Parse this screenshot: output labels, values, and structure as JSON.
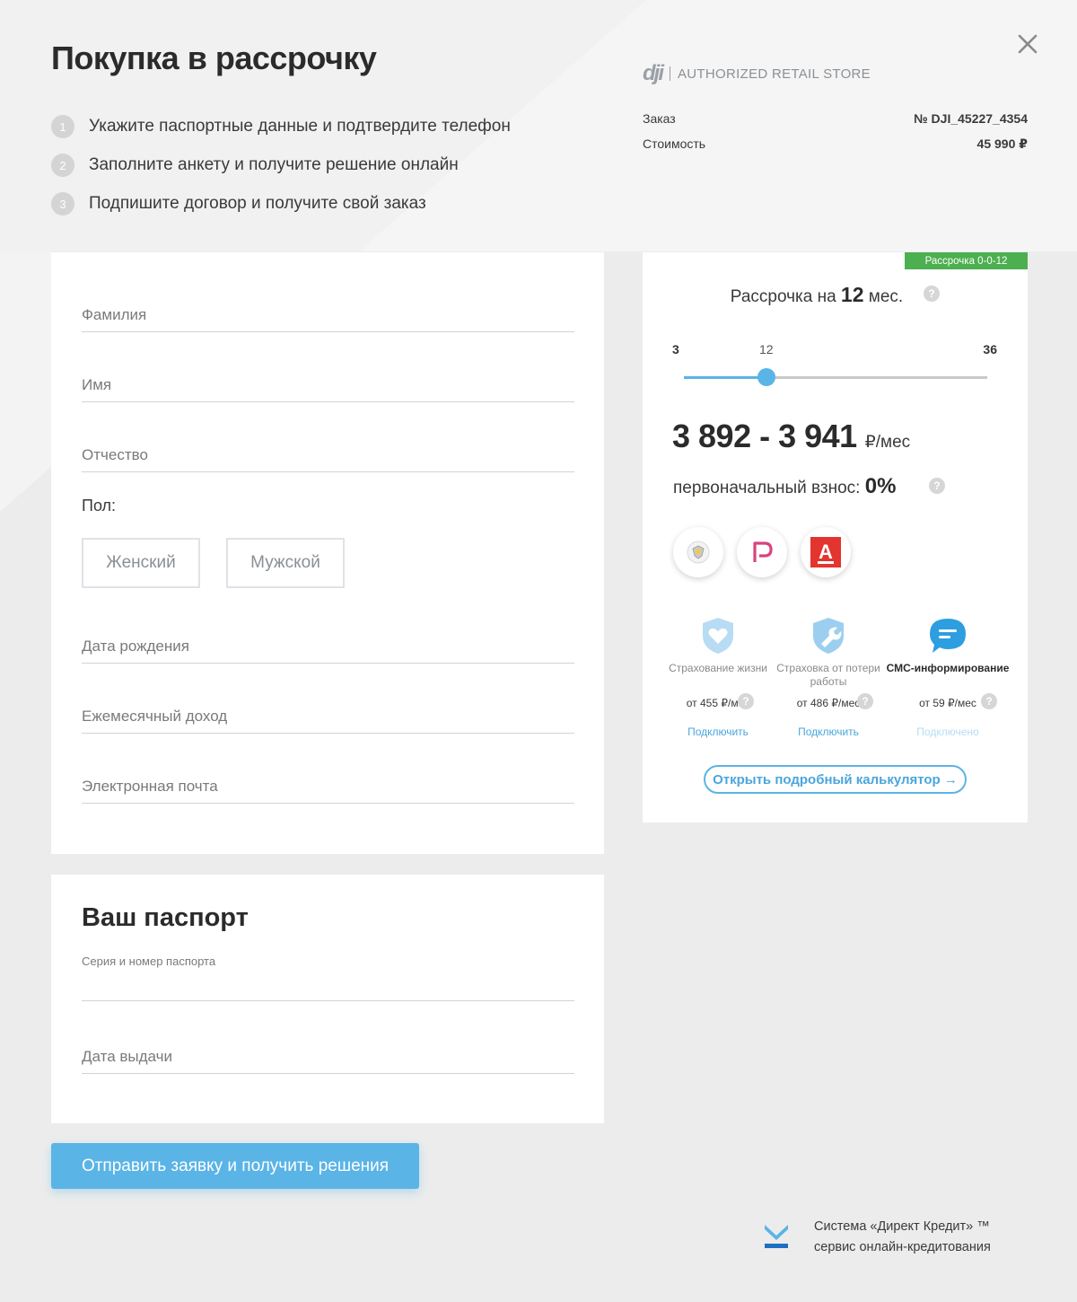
{
  "page": {
    "title": "Покупка в рассрочку"
  },
  "steps": [
    {
      "num": "1",
      "text": "Укажите паспортные данные и подтвердите телефон"
    },
    {
      "num": "2",
      "text": "Заполните анкету и получите решение онлайн"
    },
    {
      "num": "3",
      "text": "Подпишите договор и получите свой заказ"
    }
  ],
  "brand": {
    "logo": "dji",
    "text": "AUTHORIZED RETAIL STORE",
    "logo_color": "#9aa0a6"
  },
  "order": {
    "order_label": "Заказ",
    "order_value": "№ DJI_45227_4354",
    "price_label": "Стоимость",
    "price_value": "45 990 ₽"
  },
  "form": {
    "last_name": "Фамилия",
    "first_name": "Имя",
    "middle_name": "Отчество",
    "gender_label": "Пол:",
    "gender_female": "Женский",
    "gender_male": "Мужской",
    "birth_date": "Дата рождения",
    "income": "Ежемесячный доход",
    "email": "Электронная почта"
  },
  "passport": {
    "title": "Ваш паспорт",
    "series_number": "Серия и номер паспорта",
    "issue_date": "Дата выдачи"
  },
  "submit": {
    "label": "Отправить заявку и получить решения",
    "color": "#5ab4e6"
  },
  "calculator": {
    "promo_badge": "Рассрочка 0-0-12",
    "promo_color": "#4caf50",
    "term_prefix": "Рассрочка на",
    "term_value": "12",
    "term_suffix": "мес.",
    "help": "?",
    "slider_min": "3",
    "slider_current": "12",
    "slider_max": "36",
    "slider_min_value": 3,
    "slider_value": 12,
    "slider_max_value": 36,
    "payment_range": "3 892 - 3 941",
    "payment_unit": "₽/мес",
    "down_label": "первоначальный взнос:",
    "down_value": "0%",
    "banks": [
      {
        "name": "tinkoff-logo"
      },
      {
        "name": "renaissance-logo"
      },
      {
        "name": "alfa-logo",
        "letter": "А"
      }
    ],
    "services": [
      {
        "name": "Страхование жизни",
        "price": "от 455 ₽/мес",
        "action": "Подключить",
        "icon": "heart-shield-icon"
      },
      {
        "name": "Страховка от потери работы",
        "price": "от 486 ₽/мес",
        "action": "Подключить",
        "icon": "wrench-shield-icon"
      },
      {
        "name": "СМС-информирование",
        "price": "от 59 ₽/мес",
        "action": "Подключено",
        "icon": "chat-bubble-icon"
      }
    ],
    "calc_link": "Открыть подробный калькулятор →",
    "accent_color": "#5ab4e6"
  },
  "footer": {
    "line1": "Система «Директ Кредит» ™",
    "line2": "сервис онлайн-кредитования"
  }
}
